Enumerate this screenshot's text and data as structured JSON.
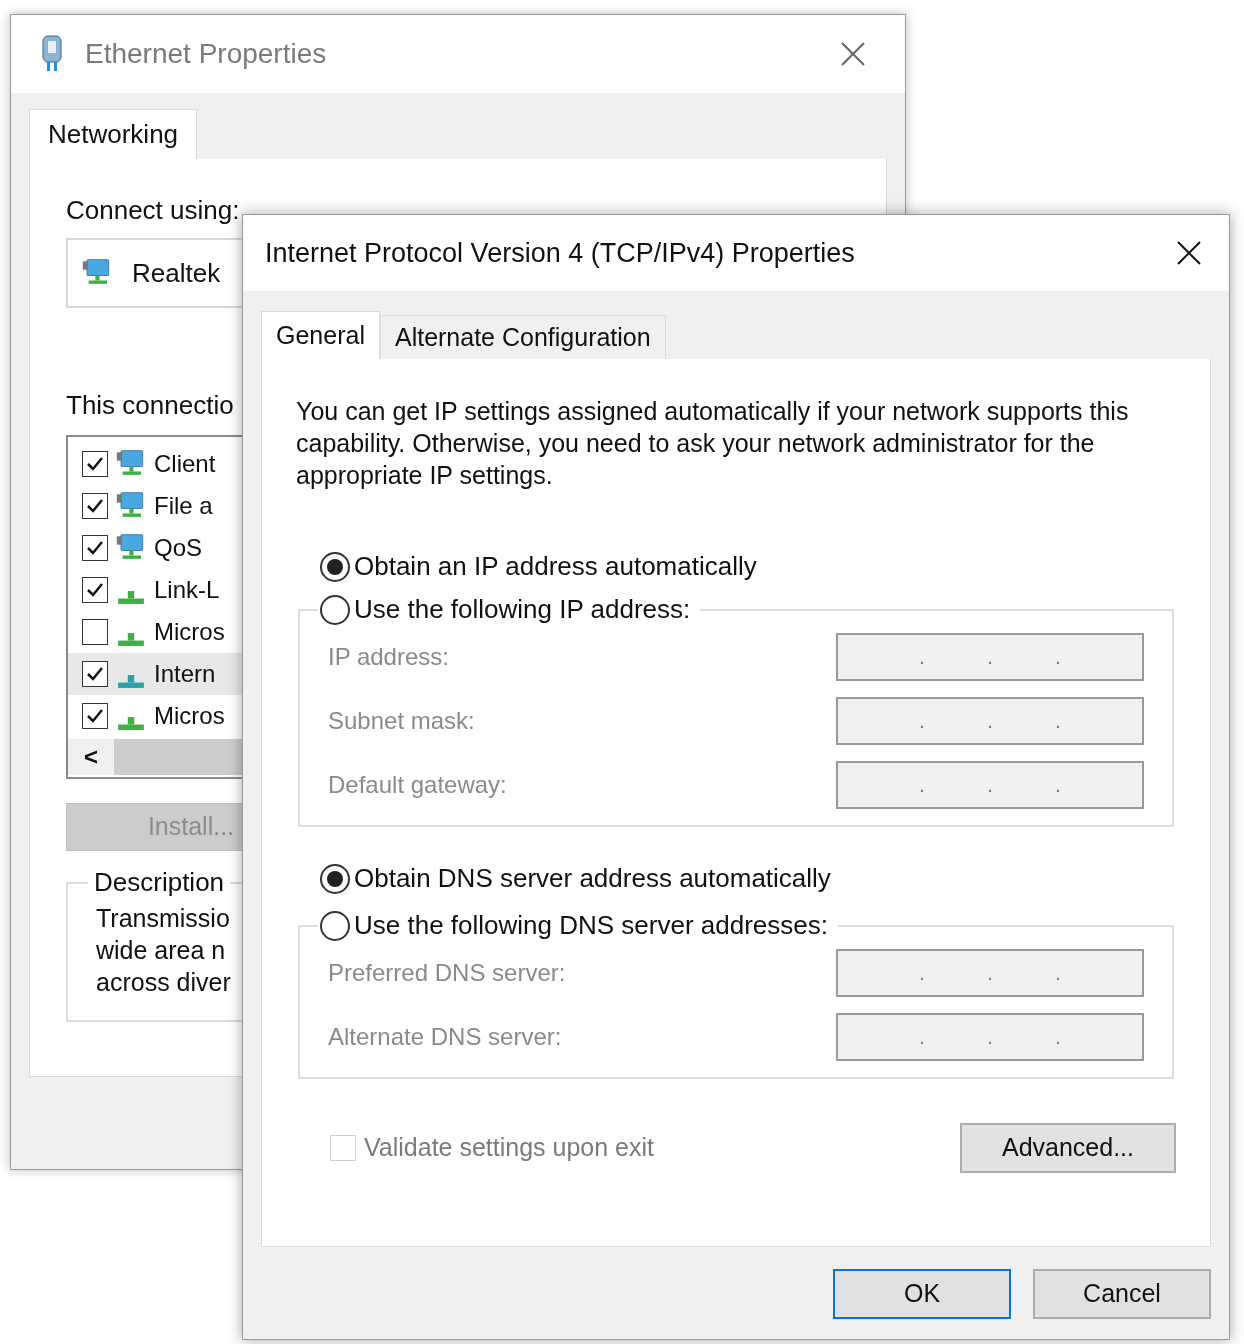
{
  "back_window": {
    "title": "Ethernet Properties",
    "tabs": [
      {
        "label": "Networking",
        "selected": true
      }
    ],
    "connect_using_label": "Connect using:",
    "adapter": "Realtek",
    "components_label": "This connectio",
    "components": [
      {
        "label": "Client",
        "kind": "service",
        "checked": true,
        "selected": false
      },
      {
        "label": "File a",
        "kind": "service",
        "checked": true,
        "selected": false
      },
      {
        "label": "QoS",
        "kind": "service",
        "checked": true,
        "selected": false
      },
      {
        "label": "Link-L",
        "kind": "protocol",
        "checked": true,
        "selected": false
      },
      {
        "label": "Micros",
        "kind": "protocol",
        "checked": false,
        "selected": false
      },
      {
        "label": "Intern",
        "kind": "protocol",
        "checked": true,
        "selected": true
      },
      {
        "label": "Micros",
        "kind": "protocol",
        "checked": true,
        "selected": false
      }
    ],
    "scroll_left": "<",
    "install_button": {
      "label": "Install...",
      "disabled": true
    },
    "description_label": "Description",
    "description_lines": [
      "Transmissio",
      "wide area n",
      "across diver"
    ]
  },
  "front_window": {
    "title": "Internet Protocol Version 4 (TCP/IPv4) Properties",
    "tabs": [
      {
        "label": "General",
        "selected": true
      },
      {
        "label": "Alternate Configuration",
        "selected": false
      }
    ],
    "intro": "You can get IP settings assigned automatically if your network supports this capability. Otherwise, you need to ask your network administrator for the appropriate IP settings.",
    "ip_options": [
      {
        "label": "Obtain an IP address automatically",
        "selected": true
      },
      {
        "label": "Use the following IP address:",
        "selected": false
      }
    ],
    "ip_fields": [
      {
        "label": "IP address:",
        "disabled": true,
        "separators": [
          ".",
          ".",
          "."
        ]
      },
      {
        "label": "Subnet mask:",
        "disabled": true,
        "separators": [
          ".",
          ".",
          "."
        ]
      },
      {
        "label": "Default gateway:",
        "disabled": true,
        "separators": [
          ".",
          ".",
          "."
        ]
      }
    ],
    "dns_options": [
      {
        "label": "Obtain DNS server address automatically",
        "selected": true
      },
      {
        "label": "Use the following DNS server addresses:",
        "selected": false
      }
    ],
    "dns_fields": [
      {
        "label": "Preferred DNS server:",
        "disabled": true,
        "separators": [
          ".",
          ".",
          "."
        ]
      },
      {
        "label": "Alternate DNS server:",
        "disabled": true,
        "separators": [
          ".",
          ".",
          "."
        ]
      }
    ],
    "validate": {
      "label": "Validate settings upon exit",
      "checked": false,
      "disabled": true
    },
    "advanced_button": "Advanced...",
    "buttons": [
      {
        "label": "OK",
        "default": true
      },
      {
        "label": "Cancel",
        "default": false
      }
    ]
  }
}
